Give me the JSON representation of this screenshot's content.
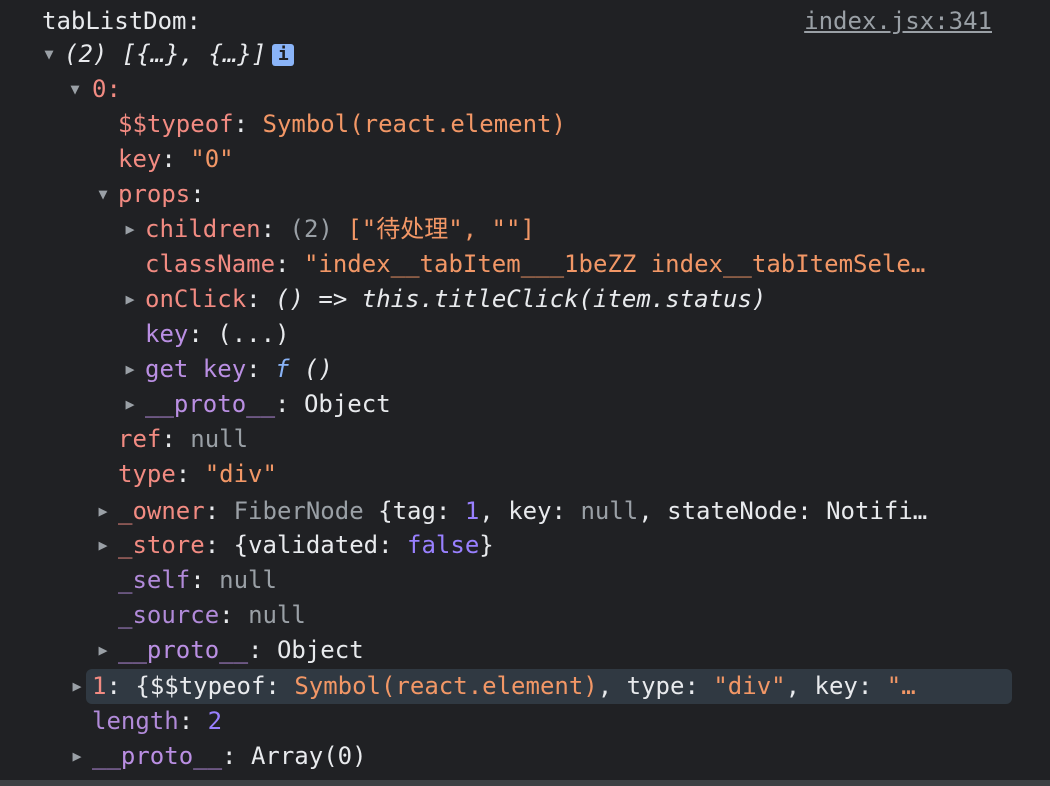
{
  "log_label": "tabListDom:",
  "source_link": "index.jsx:341",
  "array_preview": "(2) [{…}, {…}]",
  "info_icon": "i",
  "punct": {
    "colon": ":",
    "colon_space": ": ",
    "comma_space": ", ",
    "open_brace": "{",
    "close_brace": "}",
    "arrow": "=>",
    "dots": "(...)"
  },
  "entries": {
    "item0_key": "0:",
    "typeof_key": "$$typeof",
    "typeof_val": "Symbol(react.element)",
    "key_key": "key",
    "key_val": "\"0\"",
    "props_key": "props",
    "children_key": "children",
    "children_count": "(2)",
    "children_val": "[\"待处理\", \"\"]",
    "classname_key": "className",
    "classname_val": "\"index__tabItem___1beZZ index__tabItemSele…",
    "onclick_key": "onClick",
    "onclick_params": "()",
    "onclick_body": "this.titleClick(item.status)",
    "propkey_key": "key",
    "getkey_key": "get key",
    "getkey_f": "f",
    "getkey_params": "()",
    "proto1_key": "__proto__",
    "proto1_val": "Object",
    "ref_key": "ref",
    "ref_val": "null",
    "type_key": "type",
    "type_val": "\"div\"",
    "owner_key": "_owner",
    "owner_class": "FiberNode",
    "owner_tag_key": "tag",
    "owner_tag_val": "1",
    "owner_key_key": "key",
    "owner_key_val": "null",
    "owner_state_key": "stateNode",
    "owner_state_val": "Notifi…",
    "store_key": "_store",
    "store_validated_key": "validated",
    "store_validated_val": "false",
    "self_key": "_self",
    "self_val": "null",
    "source_key": "_source",
    "source_val": "null",
    "proto2_key": "__proto__",
    "proto2_val": "Object",
    "item1_key": "1",
    "item1_typeof_key": "$$typeof",
    "item1_typeof_val": "Symbol(react.element)",
    "item1_type_key": "type",
    "item1_type_val": "\"div\"",
    "item1_key_key": "key",
    "item1_key_val": "\"…",
    "length_key": "length",
    "length_val": "2",
    "proto3_key": "__proto__",
    "proto3_val": "Array(0)"
  },
  "colors": {
    "background": "#202124",
    "own_key": "#f28b82",
    "inherited_key": "#ba8fe3",
    "string": "#f29766",
    "number": "#9980ff",
    "function": "#8ab4f8",
    "highlight_row": "#303942"
  },
  "icons": {
    "expanded": "triangle-down-icon",
    "collapsed": "triangle-right-icon",
    "info": "info-icon"
  }
}
